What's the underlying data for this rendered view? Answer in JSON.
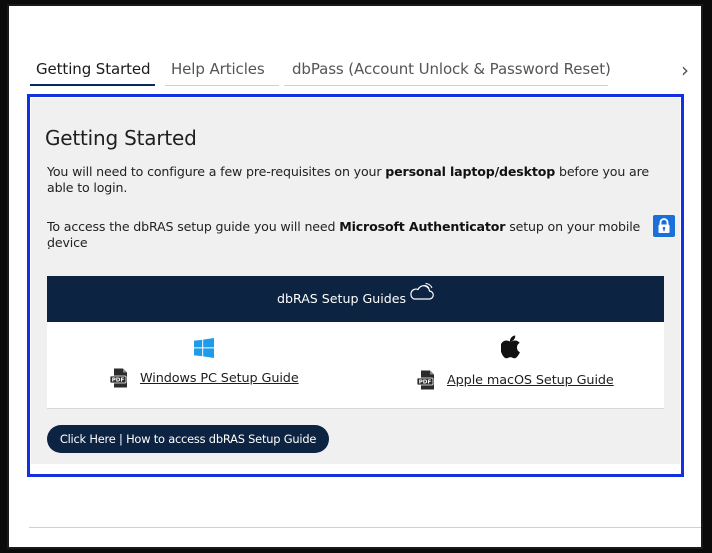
{
  "tabs": [
    {
      "label": "Getting Started",
      "active": true
    },
    {
      "label": "Help Articles",
      "active": false
    },
    {
      "label": "dbPass (Account Unlock & Password Reset)",
      "active": false
    }
  ],
  "tab_next_glyph": "›",
  "panel": {
    "title": "Getting Started",
    "para1": {
      "before": "You will need to configure a few pre-requisites on your ",
      "bold": "personal laptop/desktop",
      "after": " before you are able to login."
    },
    "para2": {
      "before": "To access the dbRAS setup guide you will need ",
      "bold": "Microsoft Authenticator",
      "after": " setup on your mobile device",
      "trailing": "."
    },
    "guides": {
      "header": "dbRAS Setup Guides",
      "windows_link": "Windows PC Setup Guide",
      "mac_link": "Apple macOS Setup Guide"
    },
    "cta_label": "Click Here | How to access dbRAS Setup Guide"
  },
  "colors": {
    "highlight_border": "#1530e0",
    "navy": "#0d2342",
    "panel_bg": "#f0f0f1",
    "authenticator_blue": "#1a6fd8",
    "windows_blue": "#1e9be9",
    "pdf_dark": "#2b2b2b"
  },
  "icons": {
    "lock": "authenticator-lock-icon",
    "cloud": "cloud-icon",
    "windows": "windows-logo-icon",
    "apple": "apple-logo-icon",
    "pdf": "pdf-file-icon"
  }
}
